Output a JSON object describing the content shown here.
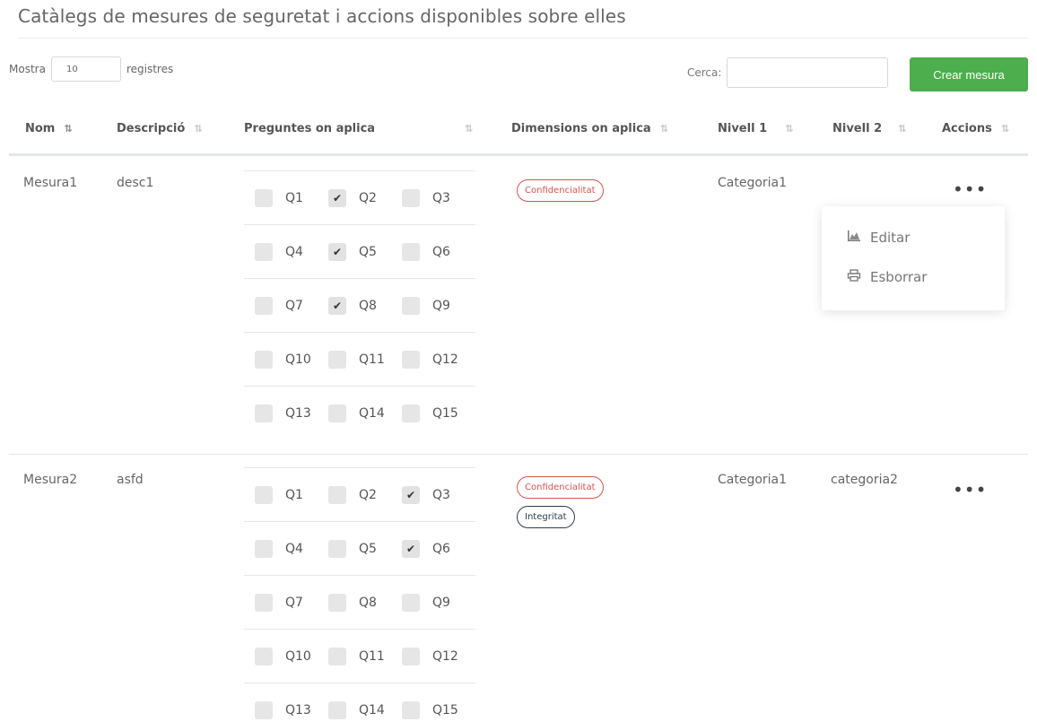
{
  "page": {
    "title": "Catàlegs de mesures de seguretat i accions disponibles sobre elles"
  },
  "controls": {
    "show_label": "Mostra",
    "length_value": "10",
    "records_label": "registres",
    "search_label": "Cerca:",
    "search_value": "",
    "create_button": "Crear mesura"
  },
  "table": {
    "headers": [
      "Nom",
      "Descripció",
      "Preguntes on aplica",
      "Dimensions on aplica",
      "Nivell 1",
      "Nivell 2",
      "Accions"
    ],
    "rows": [
      {
        "nom": "Mesura1",
        "descripcio": "desc1",
        "questions": [
          [
            {
              "label": "Q1",
              "checked": false
            },
            {
              "label": "Q2",
              "checked": true
            },
            {
              "label": "Q3",
              "checked": false
            }
          ],
          [
            {
              "label": "Q4",
              "checked": false
            },
            {
              "label": "Q5",
              "checked": true
            },
            {
              "label": "Q6",
              "checked": false
            }
          ],
          [
            {
              "label": "Q7",
              "checked": false
            },
            {
              "label": "Q8",
              "checked": true
            },
            {
              "label": "Q9",
              "checked": false
            }
          ],
          [
            {
              "label": "Q10",
              "checked": false
            },
            {
              "label": "Q11",
              "checked": false
            },
            {
              "label": "Q12",
              "checked": false
            }
          ],
          [
            {
              "label": "Q13",
              "checked": false
            },
            {
              "label": "Q14",
              "checked": false
            },
            {
              "label": "Q15",
              "checked": false
            }
          ]
        ],
        "dimensions": [
          "Confidencialitat"
        ],
        "nivell1": "Categoria1",
        "nivell2": "",
        "actions_icon": "•••"
      },
      {
        "nom": "Mesura2",
        "descripcio": "asfd",
        "questions": [
          [
            {
              "label": "Q1",
              "checked": false
            },
            {
              "label": "Q2",
              "checked": false
            },
            {
              "label": "Q3",
              "checked": true
            }
          ],
          [
            {
              "label": "Q4",
              "checked": false
            },
            {
              "label": "Q5",
              "checked": false
            },
            {
              "label": "Q6",
              "checked": true
            }
          ],
          [
            {
              "label": "Q7",
              "checked": false
            },
            {
              "label": "Q8",
              "checked": false
            },
            {
              "label": "Q9",
              "checked": false
            }
          ],
          [
            {
              "label": "Q10",
              "checked": false
            },
            {
              "label": "Q11",
              "checked": false
            },
            {
              "label": "Q12",
              "checked": false
            }
          ],
          [
            {
              "label": "Q13",
              "checked": false
            },
            {
              "label": "Q14",
              "checked": false
            },
            {
              "label": "Q15",
              "checked": false
            }
          ]
        ],
        "dimensions": [
          "Confidencialitat",
          "Integritat"
        ],
        "nivell1": "Categoria1",
        "nivell2": "categoria2",
        "actions_icon": "•••"
      }
    ]
  },
  "dropdown": {
    "items": [
      {
        "label": "Editar",
        "icon": "chart-icon"
      },
      {
        "label": "Esborrar",
        "icon": "printer-icon"
      }
    ]
  },
  "icons": {
    "sort": "⇅",
    "check": "✔"
  },
  "colors": {
    "accent_green": "#4cae4c",
    "badge_red": "#d9534f",
    "badge_dark": "#2c3e50"
  }
}
